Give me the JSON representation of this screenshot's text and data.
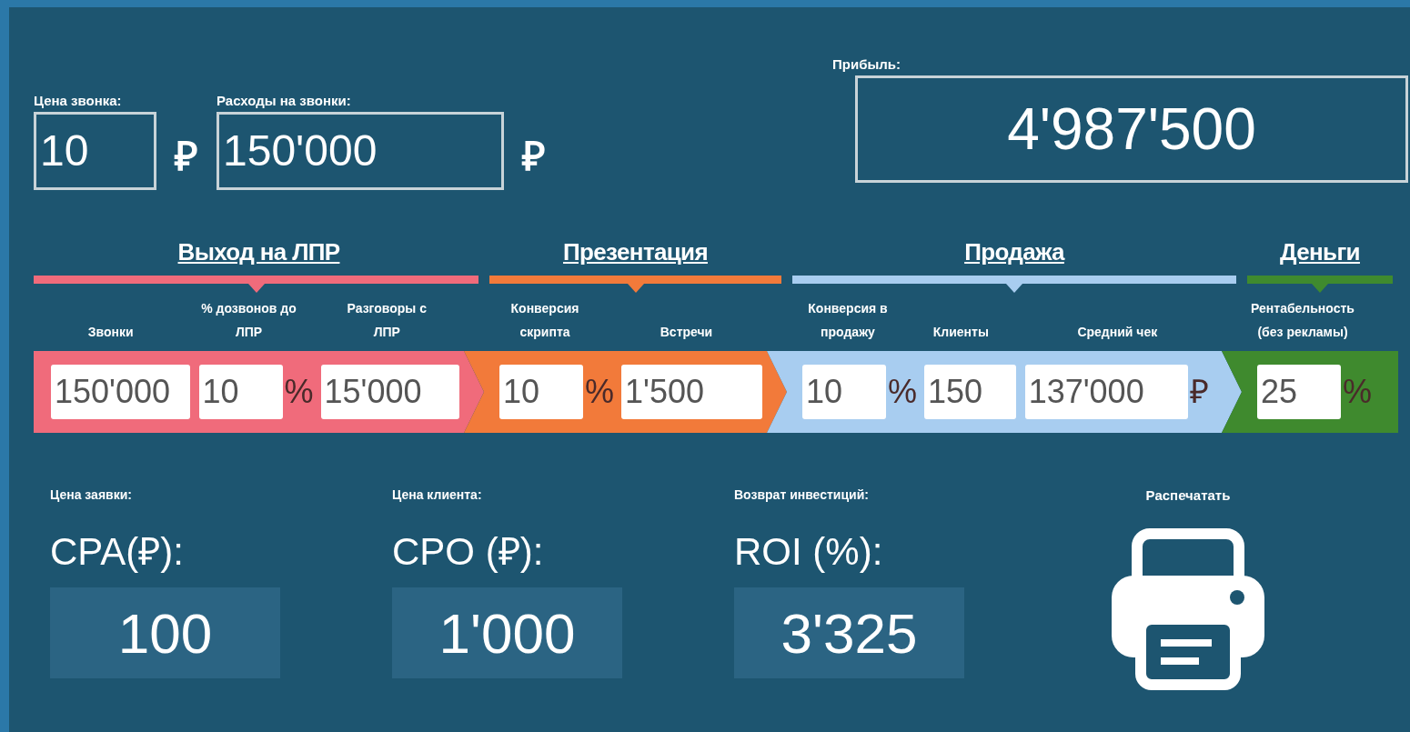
{
  "call_price": {
    "label": "Цена звонка:",
    "value": "10",
    "unit": "₽"
  },
  "call_costs": {
    "label": "Расходы на звонки:",
    "value": "150'000",
    "unit": "₽"
  },
  "profit": {
    "label": "Прибыль:",
    "value": "4'987'500"
  },
  "stages": [
    {
      "title": "Выход на ЛПР",
      "color": "#f06b7b",
      "fields": [
        {
          "label": "Звонки",
          "value": "150'000",
          "kind": "number"
        },
        {
          "label": "% дозвонов до ЛПР",
          "value": "10",
          "kind": "percent",
          "unit": "%"
        },
        {
          "label": "Разговоры с ЛПР",
          "value": "15'000",
          "kind": "number"
        }
      ]
    },
    {
      "title": "Презентация",
      "color": "#f27a3a",
      "fields": [
        {
          "label": "Конверсия скрипта",
          "value": "10",
          "kind": "percent",
          "unit": "%"
        },
        {
          "label": "Встречи",
          "value": "1'500",
          "kind": "number"
        }
      ]
    },
    {
      "title": "Продажа",
      "color": "#a8cdf0",
      "fields": [
        {
          "label": "Конверсия в продажу",
          "value": "10",
          "kind": "percent",
          "unit": "%"
        },
        {
          "label": "Клиенты",
          "value": "150",
          "kind": "number"
        },
        {
          "label": "Средний чек",
          "value": "137'000",
          "kind": "money",
          "unit": "₽"
        }
      ]
    },
    {
      "title": "Деньги",
      "color": "#3f8a2e",
      "fields": [
        {
          "label": "Рентабельность (без рекламы)",
          "value": "25",
          "kind": "percent",
          "unit": "%"
        }
      ]
    }
  ],
  "metrics": [
    {
      "caption": "Цена заявки:",
      "title": "CPA(₽):",
      "value": "100"
    },
    {
      "caption": "Цена клиента:",
      "title": "CPO (₽):",
      "value": "1'000"
    },
    {
      "caption": "Возврат инвестиций:",
      "title": "ROI (%):",
      "value": "3'325"
    }
  ],
  "print": {
    "label": "Распечатать"
  }
}
